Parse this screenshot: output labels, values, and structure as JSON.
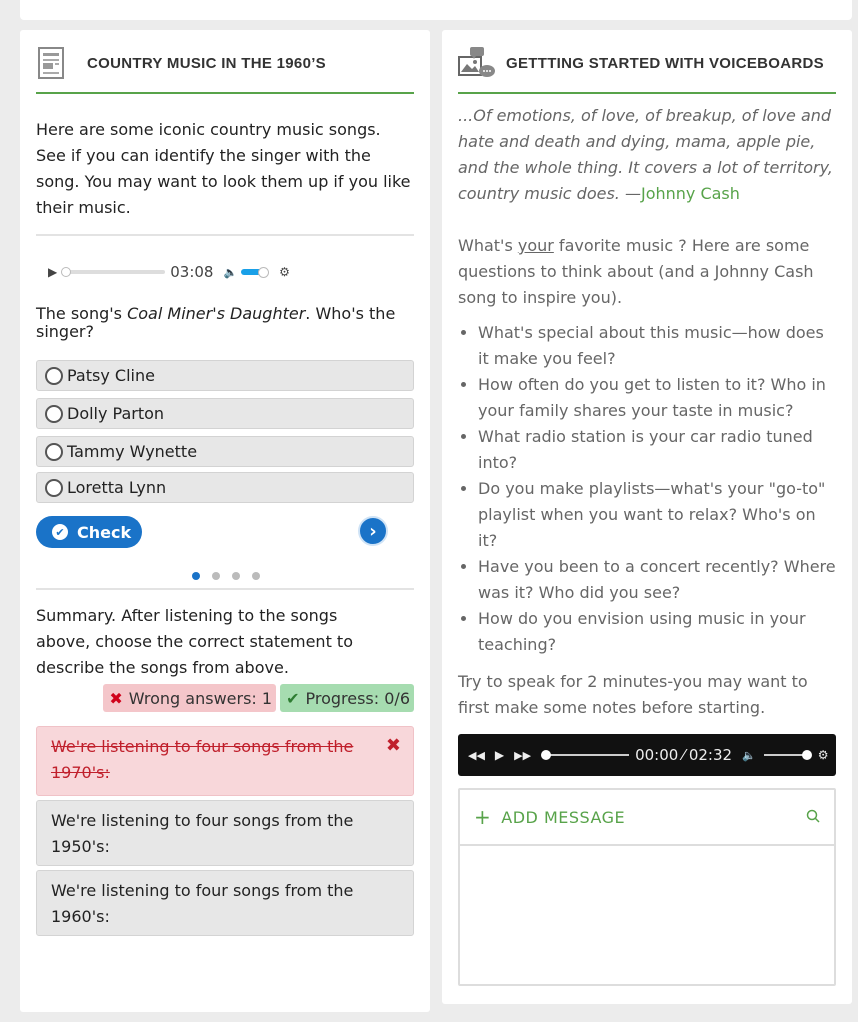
{
  "left": {
    "title": "COUNTRY MUSIC IN THE 1960’S",
    "intro": "Here are some iconic country music songs. See if you can identify the singer with the song. You may want to look them up if you like their music.",
    "audio_time": "03:08",
    "question_prefix": "The song's ",
    "question_song": "Coal Miner's Daughter",
    "question_suffix": ". Who's the singer?",
    "options": [
      "Patsy Cline",
      "Dolly Parton",
      "Tammy Wynette",
      "Loretta Lynn"
    ],
    "check_label": "Check",
    "summary_bold": "Summary",
    "summary_text": ". After listening to the songs above, choose the correct statement to describe the songs from above.",
    "wrong_answers": "Wrong answers: 1",
    "progress": "Progress: 0/6",
    "statements": [
      "We're listening to four songs from the 1970's:",
      "We're listening to four songs from the 1950's:",
      "We're listening to four songs from the 1960's:"
    ]
  },
  "right": {
    "title": "GETTTING STARTED WITH VOICEBOARDS",
    "quote": "...Of emotions, of love, of breakup, of love and hate and death and dying, mama, apple pie, and the whole thing. It covers a lot of territory, country music does. —",
    "quote_author": "Johnny Cash",
    "prompt_a": "What's ",
    "prompt_u": "your",
    "prompt_b": " favorite music ?  Here are some questions to think about (and a Johnny Cash song to inspire you).",
    "questions": [
      "What's special about this music—how does it make you feel?",
      "How often do you get to listen to it? Who in your family shares your taste in music?",
      "What radio station is your car radio tuned into?",
      "Do you make playlists—what's your \"go-to\" playlist when you want to relax? Who's on it?",
      "Have you been to a concert recently? Where was it? Who did you see?",
      "How do you envision using music in your teaching?"
    ],
    "instruction": "Try to speak for 2 minutes-you may want to first make some notes before starting.",
    "audio_current": "00:00",
    "audio_sep": "⁄",
    "audio_total": "02:32",
    "add_message": "ADD MESSAGE"
  },
  "colors": {
    "accent_green": "#58a34a",
    "accent_blue": "#1a73c8",
    "wrong_red": "#d0021b"
  },
  "icons": [
    "document-icon",
    "voiceboard-icon",
    "play-icon",
    "volume-icon",
    "settings-gear-icon",
    "radio-icon",
    "check-circle-icon",
    "next-arrow-icon",
    "times-icon",
    "check-icon",
    "rewind-icon",
    "fast-forward-icon",
    "plus-icon",
    "search-icon"
  ],
  "slide": {
    "current": 1,
    "total": 4
  }
}
